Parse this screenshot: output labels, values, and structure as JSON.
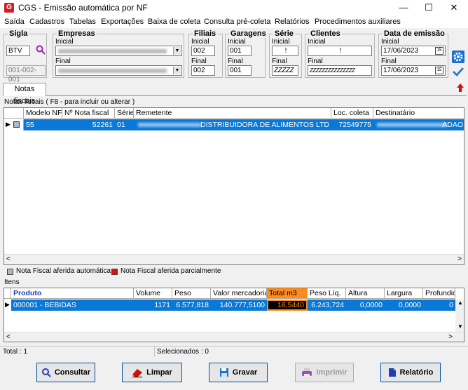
{
  "window": {
    "title": "CGS - Emissão automática por NF",
    "app_logo": "G",
    "minimize": "—",
    "maximize": "☐",
    "close": "✕"
  },
  "menu": [
    "Saída",
    "Cadastros",
    "Tabelas",
    "Exportações",
    "Baixa de coleta",
    "Consulta pré-coleta",
    "Relatórios",
    "Procedimentos auxiliares"
  ],
  "filters": {
    "sigla": {
      "label": "Sigla",
      "value": "BTV",
      "code": "001-002-001"
    },
    "empresas": {
      "label": "Empresas",
      "inicial": "Inicial",
      "final": "Final"
    },
    "filiais": {
      "label": "Filiais",
      "inicial_label": "Inicial",
      "inicial": "002",
      "final_label": "Final",
      "final": "002"
    },
    "garagens": {
      "label": "Garagens",
      "inicial_label": "Inicial",
      "inicial": "001",
      "final_label": "Final",
      "final": "001"
    },
    "serie": {
      "label": "Série",
      "inicial_label": "Inicial",
      "inicial": "!",
      "final_label": "Final",
      "final": "ZZZZZ"
    },
    "clientes": {
      "label": "Clientes",
      "inicial_label": "Inicial",
      "inicial": "!",
      "final_label": "Final",
      "final": "ZZZZZZZZZZZZZZZ"
    },
    "data_emissao": {
      "label": "Data de emissão",
      "inicial_label": "Inicial",
      "inicial": "17/06/2023",
      "final_label": "Final",
      "final": "17/06/2023"
    }
  },
  "tab": "Notas fiscais",
  "notas": {
    "caption": "Notas fiscais ( F8 - para incluir ou alterar )",
    "columns": [
      "Modelo NF",
      "Nº Nota fiscal",
      "Série",
      "Remetente",
      "Loc. coleta",
      "Destinatário"
    ],
    "row": {
      "modelo": "55",
      "numero": "52261",
      "serie": "01",
      "remetente": "DISTRIBUIDORA DE ALIMENTOS LTD",
      "loc_coleta": "72549775",
      "destinatario": "ADAO"
    }
  },
  "legend": {
    "auto": "Nota Fiscal aferida automática",
    "parcial": "Nota Fiscal aferida parcialmente",
    "auto_color": "#a9b9cc",
    "parcial_color": "#e01010"
  },
  "itens": {
    "caption": "Itens",
    "columns": [
      "Produto",
      "Volume",
      "Peso",
      "Valor mercadoria",
      "Total m3",
      "Peso Líq.",
      "Altura",
      "Largura",
      "Profundid"
    ],
    "row": {
      "produto": "000001 - BEBIDAS",
      "volume": "1171",
      "peso": "6.577,818",
      "valor": "140.777,5100",
      "total_m3": "16,5440",
      "peso_liq": "6.243,724",
      "altura": "0,0000",
      "largura": "0,0000",
      "profundidade": "0"
    }
  },
  "status": {
    "total": "Total : 1",
    "selecionados": "Selecionados : 0"
  },
  "buttons": {
    "consultar": "Consultar",
    "limpar": "Limpar",
    "gravar": "Gravar",
    "imprimir": "Imprimir",
    "relatorio": "Relatório"
  },
  "colors": {
    "selection": "#0a78d7",
    "highlight": "#ff8c1a",
    "accent": "#0050a0"
  }
}
